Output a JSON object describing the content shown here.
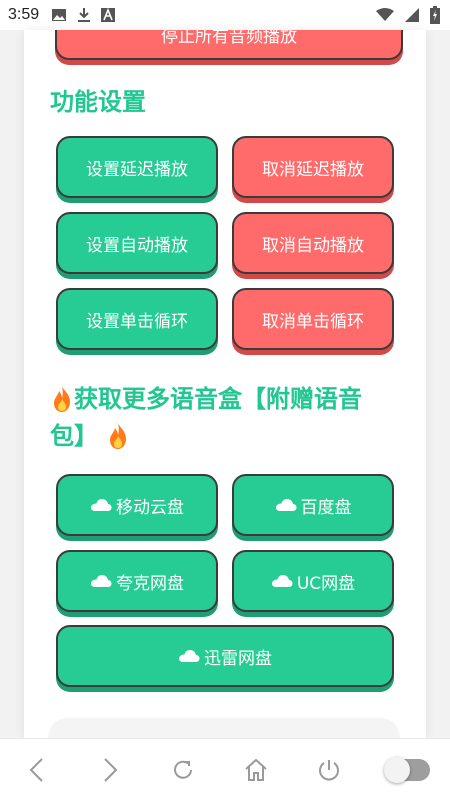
{
  "status": {
    "time": "3:59",
    "left_icons": [
      "image-icon",
      "download-icon",
      "a-icon"
    ],
    "right_icons": [
      "wifi-icon",
      "signal-icon",
      "battery-icon"
    ]
  },
  "top_button": {
    "label": "停止所有音频播放"
  },
  "function_settings": {
    "title": "功能设置",
    "buttons": [
      {
        "label": "设置延迟播放",
        "color": "green"
      },
      {
        "label": "取消延迟播放",
        "color": "red"
      },
      {
        "label": "设置自动播放",
        "color": "green"
      },
      {
        "label": "取消自动播放",
        "color": "red"
      },
      {
        "label": "设置单击循环",
        "color": "green"
      },
      {
        "label": "取消单击循环",
        "color": "red"
      }
    ]
  },
  "more": {
    "title_line1": "获取更多语音盒【附赠语音",
    "title_line2": "包】",
    "icon": "fire-icon",
    "buttons": [
      {
        "label": "移动云盘",
        "icon": "cloud-icon"
      },
      {
        "label": "百度盘",
        "icon": "cloud-icon"
      },
      {
        "label": "夸克网盘",
        "icon": "cloud-icon"
      },
      {
        "label": "UC网盘",
        "icon": "cloud-icon"
      },
      {
        "label": "迅雷网盘",
        "icon": "cloud-icon"
      }
    ]
  },
  "colors": {
    "accent_green": "#21c690",
    "button_green": "#27cc95",
    "button_red": "#ff6b6b",
    "border": "#3b3b3b"
  },
  "bottom_nav": {
    "icons": [
      "back-icon",
      "forward-icon",
      "refresh-icon",
      "home-icon",
      "power-icon",
      "toggle-switch"
    ]
  }
}
